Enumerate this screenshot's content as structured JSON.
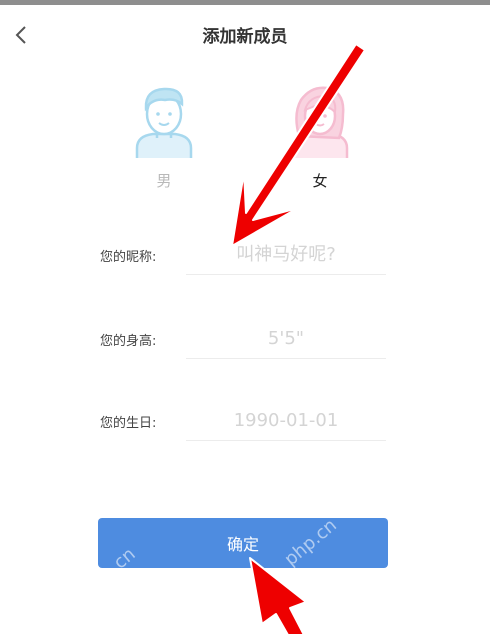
{
  "header": {
    "title": "添加新成员",
    "back_icon": "chevron-left-icon"
  },
  "gender": {
    "male": {
      "label": "男",
      "icon": "male-avatar-icon",
      "selected": false
    },
    "female": {
      "label": "女",
      "icon": "female-avatar-icon",
      "selected": true
    }
  },
  "form": {
    "nickname": {
      "label": "您的昵称:",
      "placeholder": "叫神马好呢?"
    },
    "height": {
      "label": "您的身高:",
      "placeholder": "5'5\""
    },
    "birthday": {
      "label": "您的生日:",
      "placeholder": "1990-01-01"
    }
  },
  "confirm": {
    "label": "确定"
  },
  "colors": {
    "accent": "#4e8ce0",
    "male_avatar": "#a7d8ee",
    "female_avatar": "#f5bcd0",
    "annotation_arrow": "#ee0000"
  },
  "watermark": {
    "left": "cn",
    "right": "php.cn"
  }
}
